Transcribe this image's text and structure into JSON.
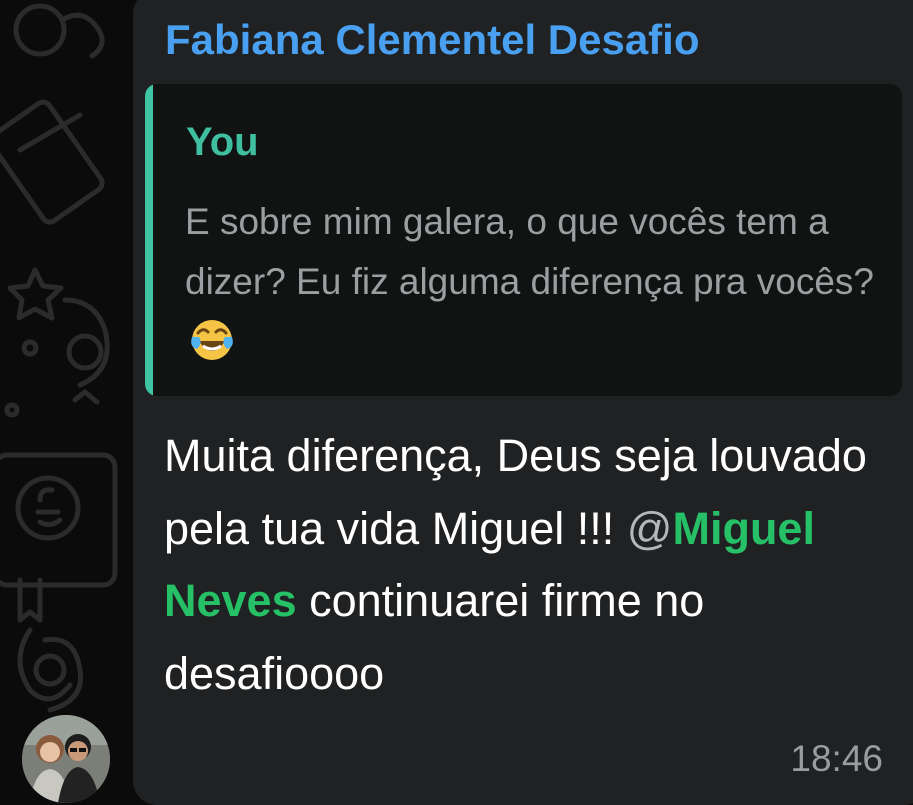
{
  "chat": {
    "message": {
      "sender_name": "Fabiana Clementel Desafio",
      "sender_color": "#4aa0f0",
      "reply": {
        "author": "You",
        "author_color": "#3fbfa0",
        "text": "E sobre mim galera, o que vocês tem a dizer? Eu fiz alguma diferença pra vocês?",
        "emoji": "face-with-tears-of-joy-emoji"
      },
      "body_before_mention": "Muita diferença, Deus seja louvado pela tua vida Miguel !!!",
      "mention_at": "@",
      "mention_name": "Miguel Neves",
      "mention_color": "#26c167",
      "body_after_mention": "continuarei firme no desafioooo",
      "timestamp": "18:46"
    },
    "avatar_icon": "profile-photo-avatar"
  }
}
